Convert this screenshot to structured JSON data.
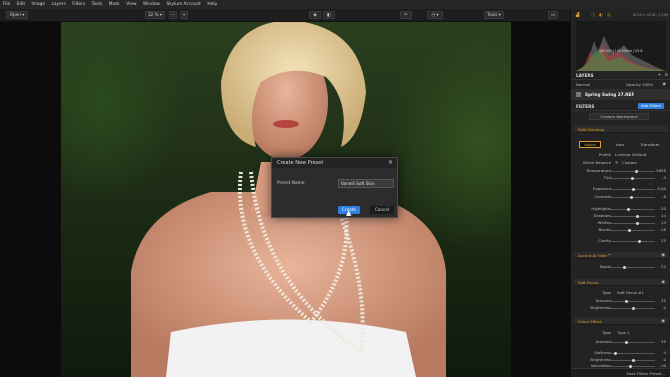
{
  "menubar": {
    "items": [
      "File",
      "Edit",
      "Image",
      "Layers",
      "Filters",
      "Tools",
      "Mask",
      "View",
      "Window",
      "Skylum Account",
      "Help"
    ]
  },
  "toolbar": {
    "open_label": "Open",
    "zoom": "32 %",
    "minus": "−",
    "plus": "+",
    "tools_label": "Tools"
  },
  "histogram": {
    "stats": "100 ISO  |  105.00mm  |  f/2.8",
    "info": "6016 × 4016  |  13.69"
  },
  "layers": {
    "title": "LAYERS",
    "blend": "Normal",
    "opacity_label": "Opacity",
    "opacity_value": "100%",
    "layer_name": "Spring Swing 27.NEF"
  },
  "filters": {
    "title": "FILTERS",
    "add_label": "Add Filters",
    "workspace": "Custom Workspace"
  },
  "raw_develop": {
    "title": "RAW Develop",
    "tabs": [
      "Adjust",
      "Lens",
      "Transform"
    ],
    "profile_label": "Profile",
    "profile_value": "Luminar Default",
    "wb_label": "White Balance",
    "wb_value": "Custom",
    "temp_label": "Temperature",
    "temp_value": "5858",
    "tint_label": "Tint",
    "tint_value": "-3",
    "exposure_label": "Exposure",
    "exposure_value": "0.00",
    "contrast_label": "Contrast",
    "contrast_value": "-8",
    "highlights_label": "Highlights",
    "highlights_value": "-20",
    "shadows_label": "Shadows",
    "shadows_value": "14",
    "whites_label": "Whites",
    "whites_value": "14",
    "blacks_label": "Blacks",
    "blacks_value": "-16",
    "clarity_label": "Clarity",
    "clarity_value": "25"
  },
  "accent": {
    "title": "Accent AI Filter™",
    "boost_label": "Boost",
    "boost_value": "22"
  },
  "soft_focus": {
    "title": "Soft Focus",
    "type_label": "Type",
    "type_value": "Soft Focus #1",
    "amount_label": "Amount",
    "amount_value": "35",
    "brightness_label": "Brightness",
    "brightness_value": "0"
  },
  "orton": {
    "title": "Orton Effect",
    "type_label": "Type",
    "type_value": "Type 1",
    "amount_label": "Amount",
    "amount_value": "35",
    "softness_label": "Softness",
    "softness_value": "4",
    "brightness_label": "Brightness",
    "brightness_value": "0",
    "saturation_label": "Saturation",
    "saturation_value": "-10"
  },
  "footer": {
    "save_label": "Save Filters Preset..."
  },
  "dialog": {
    "title": "Create New Preset",
    "close": "×",
    "field_label": "Preset Name:",
    "field_value": "Vanelli Soft Skin",
    "create_label": "Create",
    "cancel_label": "Cancel"
  },
  "colors": {
    "accent": "#2f7fe0",
    "section_title": "#e0a030",
    "panel_bg": "#232323"
  }
}
